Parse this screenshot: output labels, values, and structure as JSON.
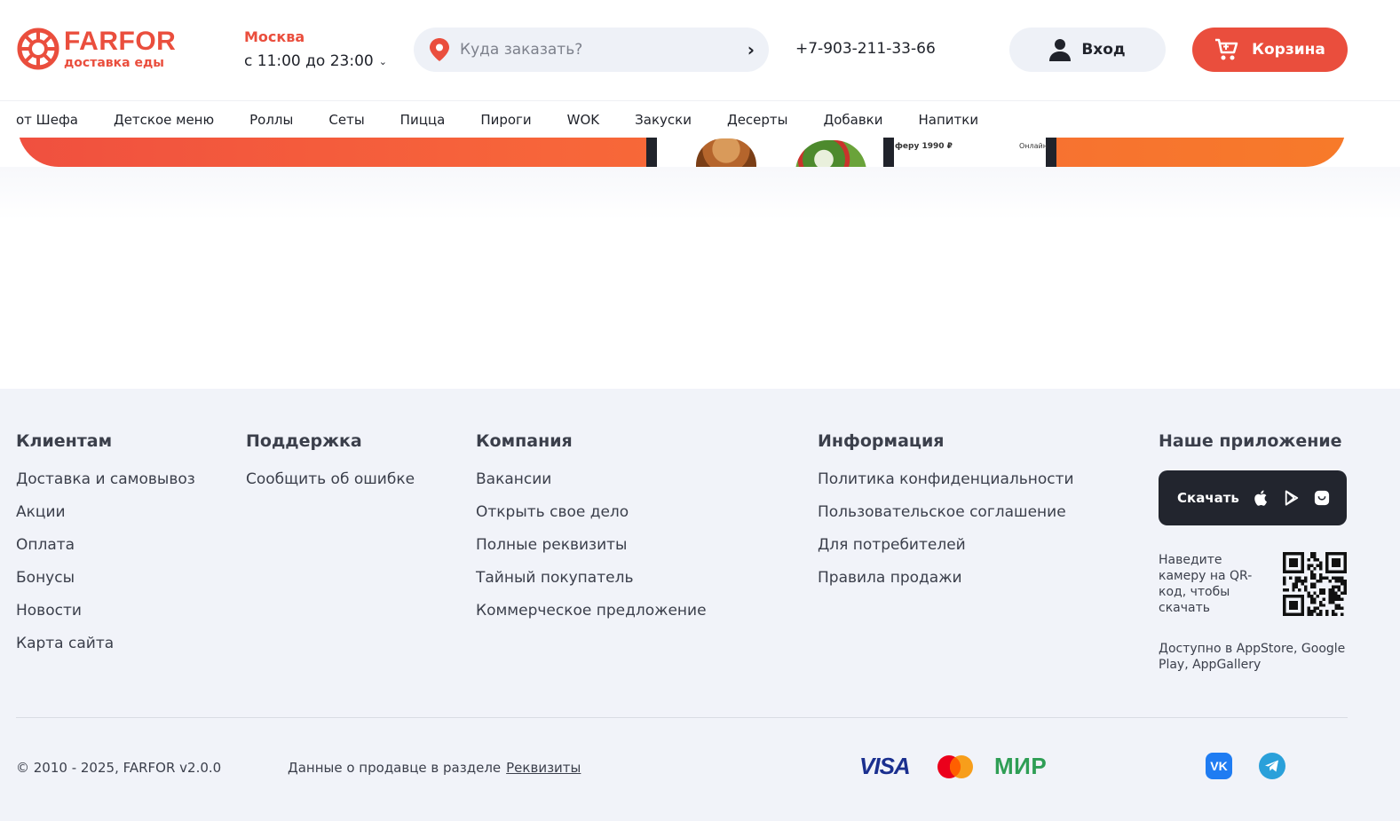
{
  "header": {
    "logo_name": "FARFOR",
    "logo_sub": "доставка еды",
    "city": "Москва",
    "hours": "с 11:00 до 23:00",
    "search_placeholder": "Куда заказать?",
    "phone": "+7-903-211-33-66",
    "login_label": "Вход",
    "cart_label": "Корзина"
  },
  "categories": [
    "от Шефа",
    "Детское меню",
    "Роллы",
    "Сеты",
    "Пицца",
    "Пироги",
    "WOK",
    "Закуски",
    "Десерты",
    "Добавки",
    "Напитки"
  ],
  "banner": {
    "price_text": "ферy 1990 ₽",
    "online_text": "Онлайн"
  },
  "footer": {
    "clients": {
      "title": "Клиентам",
      "links": [
        "Доставка и самовывоз",
        "Акции",
        "Оплата",
        "Бонусы",
        "Новости",
        "Карта сайта"
      ]
    },
    "support": {
      "title": "Поддержка",
      "links": [
        "Сообщить об ошибке"
      ]
    },
    "company": {
      "title": "Компания",
      "links": [
        "Вакансии",
        "Открыть свое дело",
        "Полные реквизиты",
        "Тайный покупатель",
        "Коммерческое предложение"
      ]
    },
    "info": {
      "title": "Информация",
      "links": [
        "Политика конфиденциальности",
        "Пользовательское соглашение",
        "Для потребителей",
        "Правила продажи"
      ]
    },
    "app": {
      "title": "Наше приложение",
      "download_label": "Скачать",
      "qr_text": "Наведите камеру на QR-код, чтобы скачать",
      "availability": "Доступно в AppStore, Google Play, AppGallery"
    },
    "copyright": "© 2010 - 2025, FARFOR v2.0.0",
    "seller_text": "Данные о продавце в разделе",
    "seller_link": "Реквизиты",
    "payments": {
      "visa": "VISA",
      "mir": "МИР"
    },
    "social": {
      "vk": "VK"
    }
  },
  "colors": {
    "brand": "#ea4e3d",
    "dark": "#22252e",
    "footer_bg": "#f1f3f9"
  }
}
